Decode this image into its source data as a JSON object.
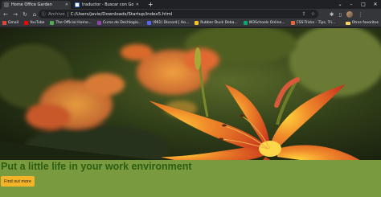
{
  "browser": {
    "tabs": [
      {
        "label": "Home Office Garden",
        "active": true,
        "favicon_color": "#5f6368"
      },
      {
        "label": "traductor - Buscar con Google",
        "active": false,
        "favicon_color": "#4285f4"
      }
    ],
    "window_controls": {
      "minimize": "–",
      "maximize": "□",
      "close": "✕"
    },
    "address_bar": {
      "prefix": "Archivo",
      "url": "C:/Users/javie/Downloads/Startup/index5.html"
    },
    "bookmarks": [
      {
        "label": "Gmail",
        "color": "#ea4335"
      },
      {
        "label": "YouTube",
        "color": "#ff0000"
      },
      {
        "label": "The Official Home...",
        "color": "#4caf50"
      },
      {
        "label": "Curso de Dechlogia...",
        "color": "#8e44ad"
      },
      {
        "label": "(961) Discord | Ho...",
        "color": "#5865f2"
      },
      {
        "label": "Rubber Duck Deba...",
        "color": "#f5c518"
      },
      {
        "label": "W3Schools Online...",
        "color": "#04aa6d"
      },
      {
        "label": "CSS-Tricks - Tips, Tri...",
        "color": "#e8663d"
      }
    ],
    "bookmarks_folder": "Otros favoritos"
  },
  "page": {
    "headline": "Put a little life in your work environment",
    "cta_label": "Find out more",
    "colors": {
      "banner": "#7a9a40",
      "headline": "#2c5e11",
      "cta": "#f4b42a"
    }
  }
}
